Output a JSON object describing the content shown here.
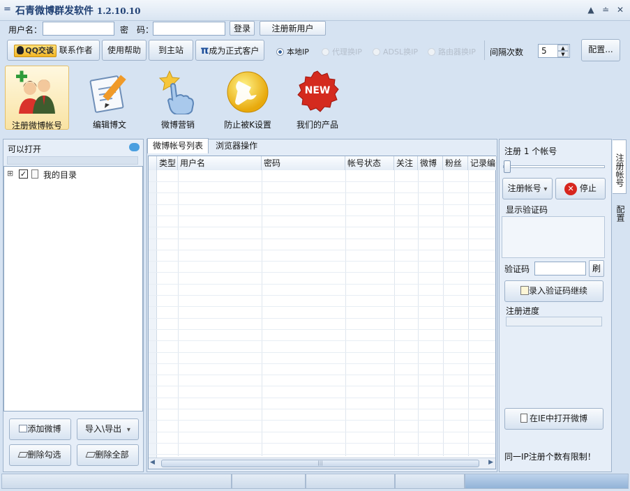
{
  "window": {
    "title": "石青微博群发软件",
    "version": "1.2.10.10",
    "sys_menu": "=",
    "minimize": "▲",
    "restore": "≐",
    "close": "✕"
  },
  "login": {
    "username_label": "用户名：",
    "password_label": "密　码：",
    "username_value": "",
    "password_value": "",
    "login_button": "登录",
    "register_button": "注册新用户"
  },
  "toolbar": {
    "qq_badge": "QQ交谈",
    "contact_author": "联系作者",
    "help": "使用帮助",
    "home": "到主站",
    "pi_symbol": "π",
    "become_customer": "成为正式客户",
    "interval_label": "间隔次数",
    "interval_value": "5",
    "config_button": "配置..."
  },
  "ip_modes": [
    {
      "label": "本地IP",
      "checked": true,
      "enabled": true
    },
    {
      "label": "代理换IP",
      "checked": false,
      "enabled": false
    },
    {
      "label": "ADSL换IP",
      "checked": false,
      "enabled": false
    },
    {
      "label": "路由器换IP",
      "checked": false,
      "enabled": false
    }
  ],
  "big_toolbar": [
    {
      "label": "注册微博帐号",
      "icon": "users-add-icon"
    },
    {
      "label": "编辑博文",
      "icon": "edit-document-icon"
    },
    {
      "label": "微博营销",
      "icon": "pointing-hand-icon"
    },
    {
      "label": "防止被K设置",
      "icon": "wrench-icon"
    },
    {
      "label": "我们的产品",
      "icon": "new-badge-icon",
      "badge_text": "NEW"
    }
  ],
  "left_panel": {
    "header": "可以打开",
    "tree_root": "我的目录",
    "expander": "⊞",
    "checkmark": "✓",
    "add_weibo": "添加微博",
    "import_export": "导入\\导出",
    "delete_checked": "删除勾选",
    "delete_all": "删除全部"
  },
  "center": {
    "tabs": [
      "微博帐号列表",
      "浏览器操作"
    ],
    "columns": [
      "类型",
      "用户名",
      "密码",
      "帐号状态",
      "关注",
      "微博",
      "粉丝",
      "记录编号"
    ],
    "scroll_left": "◀",
    "scroll_right": "▶",
    "scroll_grip": "|||"
  },
  "right_panel": {
    "register_count_label": "注册 1 个帐号",
    "register_count_value": 1,
    "register_dropdown": "注册帐号",
    "dropdown_arrow": "▾",
    "stop_button": "停止",
    "stop_icon_glyph": "✕",
    "captcha_display_label": "显示验证码",
    "captcha_label": "验证码",
    "refresh_button": "刷",
    "submit_captcha": "录入验证码继续",
    "progress_label": "注册进度",
    "progress_value": 0,
    "open_in_ie": "在IE中打开微博",
    "ip_limit_note": "同一IP注册个数有限制！"
  },
  "side_tabs": [
    "注册帐号",
    "配置"
  ],
  "spinner": {
    "up": "▲",
    "down": "▼"
  }
}
